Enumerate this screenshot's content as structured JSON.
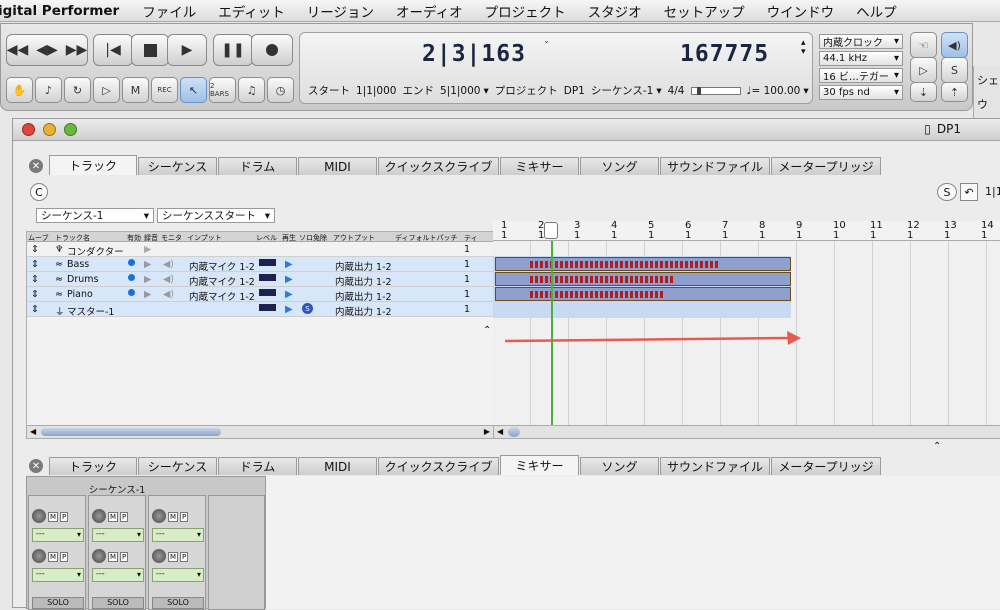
{
  "menubar": {
    "app": "igital Performer",
    "items": [
      "ファイル",
      "エディット",
      "リージョン",
      "オーディオ",
      "プロジェクト",
      "スタジオ",
      "セットアップ",
      "ウインドウ",
      "ヘルプ"
    ]
  },
  "transport": {
    "buttons": [
      "rewind",
      "back",
      "forward",
      "to-start",
      "stop",
      "play",
      "pause",
      "record"
    ],
    "small_buttons": [
      "REC",
      "2 BARS"
    ],
    "counter_main": "2|3|163",
    "counter_samples": "167775",
    "start_label": "スタート",
    "start_value": "1|1|000",
    "end_label": "エンド",
    "end_value": "5|1|000",
    "project_label": "プロジェクト",
    "project_value": "DP1",
    "sequence": "シーケンス-1",
    "meter": "4/4",
    "tempo_label": "♩= 100.00",
    "clock": "内蔵クロック",
    "sample_rate": "44.1 kHz",
    "bit_depth": "16 ビ…テガー",
    "fps": "30 fps nd",
    "side_chars": [
      "シェ",
      "ウ"
    ]
  },
  "window": {
    "title": "DP1",
    "tabs_top": [
      "トラック",
      "シーケンス",
      "ドラム",
      "MIDI",
      "クイックスクライブ",
      "ミキサー",
      "ソング",
      "サウンドファイル",
      "メータープリッジ"
    ],
    "active_top": 0,
    "tabs_bottom": [
      "トラック",
      "シーケンス",
      "ドラム",
      "MIDI",
      "クイックスクライブ",
      "ミキサー",
      "ソング",
      "サウンドファイル",
      "メータープリッジ"
    ],
    "active_bottom": 5,
    "seq_select": "シーケンス-1",
    "seq_start": "シーケンススタート",
    "c_button": "C",
    "s_button": "S",
    "right_mark": "1|1"
  },
  "tracklist": {
    "headers": [
      "ムーブ",
      "トラック名",
      "有効",
      "録音",
      "モニタ",
      "インプット",
      "レベル",
      "再生",
      "ソロ免除",
      "アウトプット",
      "ディフォルトパッチ",
      "ティ"
    ],
    "rows": [
      {
        "name": "コンダクター",
        "input": "",
        "output": "",
        "num": "1"
      },
      {
        "name": "Bass",
        "input": "内蔵マイク 1-2",
        "output": "内蔵出力 1-2",
        "num": "1"
      },
      {
        "name": "Drums",
        "input": "内蔵マイク 1-2",
        "output": "内蔵出力 1-2",
        "num": "1"
      },
      {
        "name": "Piano",
        "input": "内蔵マイク 1-2",
        "output": "内蔵出力 1-2",
        "num": "1"
      },
      {
        "name": "マスター-1",
        "input": "",
        "output": "内蔵出力 1-2",
        "num": "1"
      }
    ]
  },
  "ruler": [
    "1",
    "2",
    "3",
    "4",
    "5",
    "6",
    "7",
    "8",
    "9",
    "10",
    "11",
    "12",
    "13",
    "14"
  ],
  "mixer": {
    "sequence_label": "シーケンス-1",
    "channels": [
      "ch1",
      "ch2",
      "ch3"
    ],
    "solo": "SOLO",
    "mute": "M",
    "pre": "P",
    "empty_value": "---"
  }
}
